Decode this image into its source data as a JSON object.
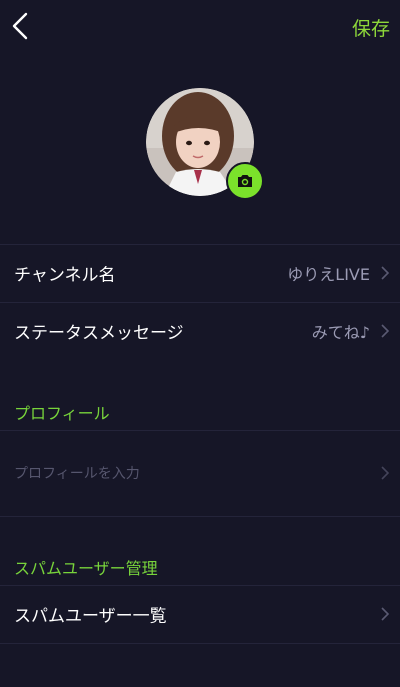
{
  "header": {
    "save_label": "保存",
    "back_icon": "chevron-left-icon"
  },
  "profile": {
    "avatar_description_icon": "profile-photo",
    "camera_icon": "camera-icon"
  },
  "rows": {
    "channel_name": {
      "label": "チャンネル名",
      "value": "ゆりえLIVE"
    },
    "status_message": {
      "label": "ステータスメッセージ",
      "value": "みてね♪"
    }
  },
  "sections": {
    "profile": {
      "title": "プロフィール",
      "placeholder": "プロフィールを入力"
    },
    "spam": {
      "title": "スパムユーザー管理",
      "list_label": "スパムユーザー一覧"
    }
  },
  "colors": {
    "background": "#161627",
    "accent_green": "#78d43b",
    "camera_badge": "#7be12b",
    "value_gray": "#9b9bb4",
    "placeholder_gray": "#56566e"
  }
}
